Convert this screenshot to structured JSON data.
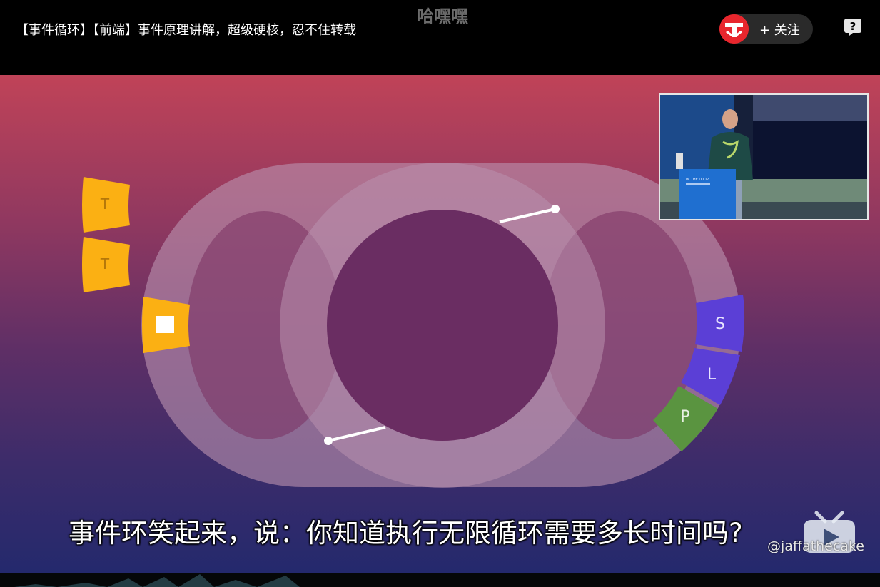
{
  "header": {
    "video_title": "【事件循环】【前端】事件原理讲解，超级硬核，忍不住转载",
    "watermark": "哈嘿嘿",
    "follow_label": "+ 关注"
  },
  "diagram": {
    "left_tiles": [
      "T",
      "T"
    ],
    "track_tiles": [
      "S",
      "L",
      "P"
    ]
  },
  "pip": {
    "slide_title": "IN THE LOOP"
  },
  "subtitle": "事件环笑起来，说：你知道执行无限循环需要多长时间吗?",
  "handle": "@jaffathecake",
  "colors": {
    "tile_yellow": "#fbb013",
    "tile_purple": "#5b3fd6",
    "tile_green": "#5a9440",
    "track": "#b991ae",
    "avatar_red": "#e8262d"
  }
}
